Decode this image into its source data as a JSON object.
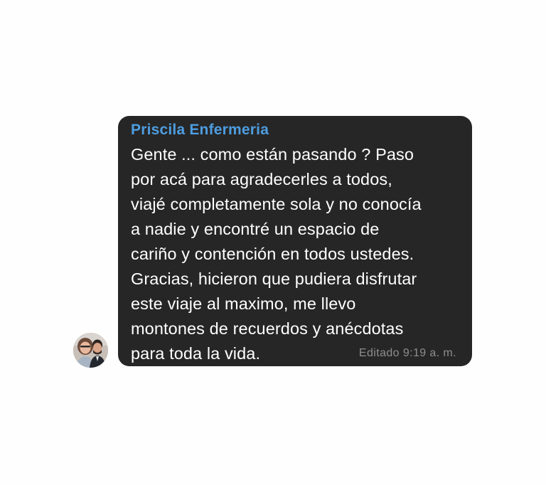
{
  "message": {
    "sender": "Priscila Enfermeria",
    "text": "Gente ... como están pasando ? Paso\npor acá para agradecerles a todos,\nviajé completamente sola y no conocía\na nadie y encontré un espacio de\ncariño y contención en todos ustedes.\nGracias, hicieron que pudiera disfrutar\neste viaje al maximo, me llevo\nmontones de recuerdos y anécdotas\npara toda la vida.",
    "edited_label": "Editado",
    "time": "9:19 a. m."
  },
  "colors": {
    "background": "#fefefe",
    "bubble": "#262626",
    "sender": "#4d9de0",
    "text": "#ffffff",
    "meta": "#8e8e8e"
  }
}
